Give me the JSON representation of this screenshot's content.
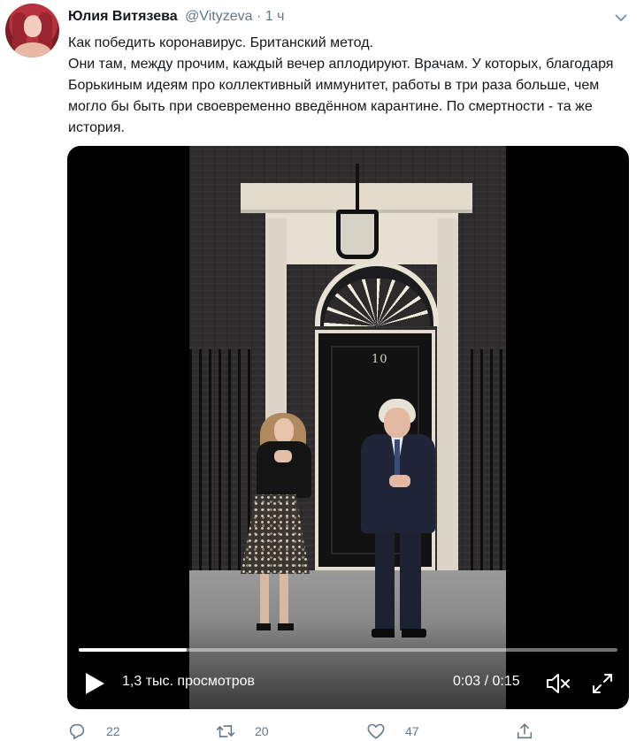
{
  "tweet": {
    "author_name": "Юлия Витязева",
    "author_handle": "@Vityzeva",
    "separator": "·",
    "time": "1 ч",
    "text_line1": "Как победить коронавирус. Британский метод.",
    "text_line2": "Они там, между прочим, каждый вечер аплодируют. Врачам. У которых, благодаря Борькиным идеям про коллективный иммунитет, работы в три раза больше, чем могло бы быть при своевременно введённом карантине. По смертности - та же история."
  },
  "video": {
    "door_number": "10",
    "views_label": "1,3 тыс. просмотров",
    "timecode": "0:03 / 0:15",
    "progress": 0.2,
    "icons": {
      "play": "play-icon",
      "volume": "volume-muted-icon",
      "fullscreen": "fullscreen-icon"
    }
  },
  "actions": {
    "reply_count": "22",
    "retweet_count": "20",
    "like_count": "47",
    "icons": {
      "reply": "reply-icon",
      "retweet": "retweet-icon",
      "like": "heart-icon",
      "share": "share-icon"
    }
  },
  "colors": {
    "secondary_text": "#657786",
    "primary_text": "#14171a",
    "media_background": "#000000"
  }
}
